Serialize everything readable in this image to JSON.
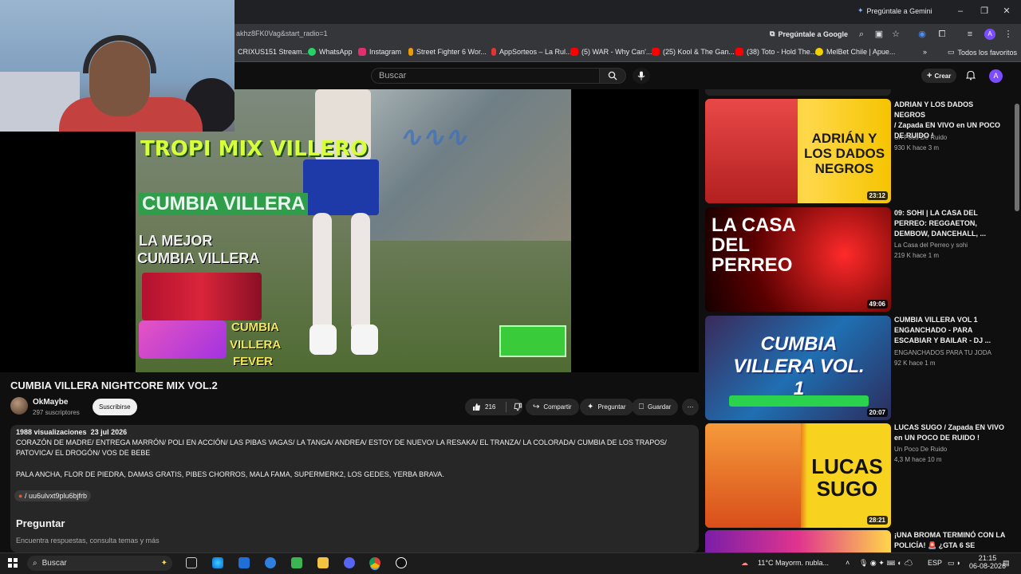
{
  "browser": {
    "url_fragment": "akhz8FK0Vag&start_radio=1",
    "gemini_label": "Pregúntale a Gemini",
    "google_chip": "Pregúntale a Google",
    "profile_initial": "A",
    "bookmarks": [
      {
        "label": "CRIXUS151 Stream...",
        "color": "#9146ff"
      },
      {
        "label": "WhatsApp",
        "color": "#25d366"
      },
      {
        "label": "Instagram",
        "color": "#e1306c"
      },
      {
        "label": "Street Fighter 6 Wor...",
        "color": "#f29b00"
      },
      {
        "label": "AppSorteos – La Rul...",
        "color": "#e3342f"
      },
      {
        "label": "(5) WAR - Why Can'...",
        "color": "#ff0000"
      },
      {
        "label": "(25) Kool & The Gan...",
        "color": "#ff0000"
      },
      {
        "label": "(38) Toto - Hold The...",
        "color": "#ff0000"
      },
      {
        "label": "MelBet Chile | Apue...",
        "color": "#f5d000"
      }
    ],
    "all_bookmarks": "Todos los favoritos"
  },
  "youtube": {
    "search_placeholder": "Buscar",
    "crear_label": "Crear",
    "avatar_initial": "A"
  },
  "video": {
    "title": "CUMBIA VILLERA NIGHTCORE MIX VOL.2",
    "frame_texts": [
      "TROPI MIX VILLERO",
      "CUMBIA VILLERA",
      "LA MEJOR",
      "CUMBIA VILLERA",
      "CUMBIA",
      "VILLERA",
      "FEVER"
    ],
    "channel": "OkMaybe",
    "subscribers": "297 suscriptores",
    "subscribe_label": "Suscribirse",
    "likes": "216",
    "share_label": "Compartir",
    "ask_label": "Preguntar",
    "save_label": "Guardar"
  },
  "description": {
    "views": "1988 visualizaciones",
    "date": "23 jul 2026",
    "line1": "CORAZÓN DE MADRE/ ENTREGA MARRÓN/ POLI EN ACCIÓN/ LAS PIBAS VAGAS/ LA TANGA/ ANDREA/ ESTOY DE NUEVO/ LA RESAKA/ EL TRANZA/ LA COLORADA/ CUMBIA DE LOS TRAPOS/",
    "line2": "PATOVICA/ EL DROGÓN/ VOS DE BEBE",
    "line3": "PALA ANCHA, FLOR DE PIEDRA, DAMAS GRATIS, PIBES CHORROS, MALA FAMA, SUPERMERK2, LOS GEDES, YERBA BRAVA.",
    "link": "/ uu6ulvxt9plu6bjfrb"
  },
  "ask": {
    "heading": "Preguntar",
    "subtitle": "Encuentra respuestas, consulta temas y más"
  },
  "recommendations": [
    {
      "title_l1": "ADRIAN Y LOS DADOS NEGROS",
      "title_l2": "/ Zapada EN VIVO en UN POCO",
      "title_l3": "DE RUIDO !",
      "channel": "Un Poco De Ruido",
      "meta": "930 K  hace 3 m",
      "duration": "23:12",
      "thumb_text": "ADRIÁN Y LOS DADOS NEGROS"
    },
    {
      "title_l1": "09: SOHI | LA CASA DEL",
      "title_l2": "PERREO: REGGAETON,",
      "title_l3": "DEMBOW, DANCEHALL, ...",
      "channel": "La Casa del Perreo y sohi",
      "meta": "219 K  hace 1 m",
      "duration": "49:06",
      "thumb_text": "LA CASA DEL PERREO"
    },
    {
      "title_l1": "CUMBIA VILLERA VOL 1",
      "title_l2": "ENGANCHADO - PARA",
      "title_l3": "ESCABIAR Y BAILAR - DJ ...",
      "channel": "ENGANCHADOS PARA TU JODA",
      "meta": "92 K  hace 1 m",
      "duration": "20:07",
      "thumb_text": "CUMBIA VILLERA VOL. 1"
    },
    {
      "title_l1": "LUCAS SUGO / Zapada EN VIVO",
      "title_l2": "en UN POCO DE RUIDO !",
      "title_l3": "",
      "channel": "Un Poco De Ruido",
      "meta": "4,3 M  hace 10 m",
      "duration": "28:21",
      "thumb_text": "LUCAS SUGO"
    },
    {
      "title_l1": "¡UNA BROMA TERMINÓ CON LA",
      "title_l2": "POLICÍA! 🚨 ¿GTA 6 SE",
      "title_l3": "",
      "channel": "",
      "meta": "",
      "duration": "",
      "thumb_text": ""
    }
  ],
  "taskbar": {
    "search_label": "Buscar",
    "weather": "11°C  Mayorm. nubla...",
    "lang": "ESP",
    "time": "21:15",
    "date": "06-08-2026"
  }
}
